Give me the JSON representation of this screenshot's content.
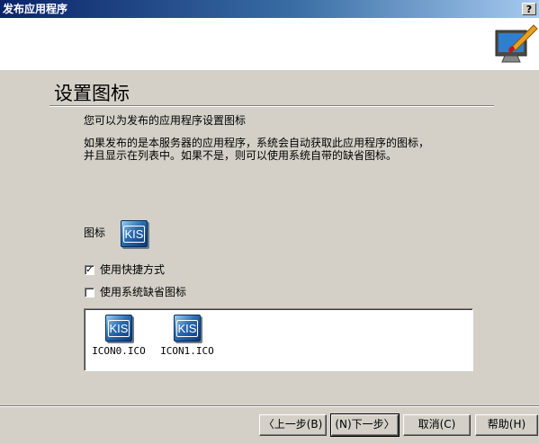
{
  "window": {
    "title": "发布应用程序",
    "help_label": "?"
  },
  "page": {
    "title": "设置图标",
    "description": "您可以为发布的应用程序设置图标",
    "info_line1": "如果发布的是本服务器的应用程序，系统会自动获取此应用程序的图标，",
    "info_line2": "并且显示在列表中。如果不是，则可以使用系统自带的缺省图标。"
  },
  "icon_section": {
    "label": "图标",
    "icon_text": "KIS"
  },
  "options": {
    "use_shortcut": {
      "label": "使用快捷方式",
      "checked": true,
      "mark": "✓"
    },
    "use_default_icon": {
      "label": "使用系统缺省图标",
      "checked": false,
      "mark": ""
    }
  },
  "icon_list": [
    {
      "icon_text": "KIS",
      "filename": "ICON0.ICO"
    },
    {
      "icon_text": "KIS",
      "filename": "ICON1.ICO"
    }
  ],
  "buttons": {
    "back": "〈上一步(B)",
    "next": "(N)下一步〉",
    "cancel": "取消(C)",
    "help": "帮助(H)"
  },
  "colors": {
    "title_bar": "#0a246a",
    "dialog_bg": "#d4d0c8",
    "banner_bg": "#ffffff"
  }
}
